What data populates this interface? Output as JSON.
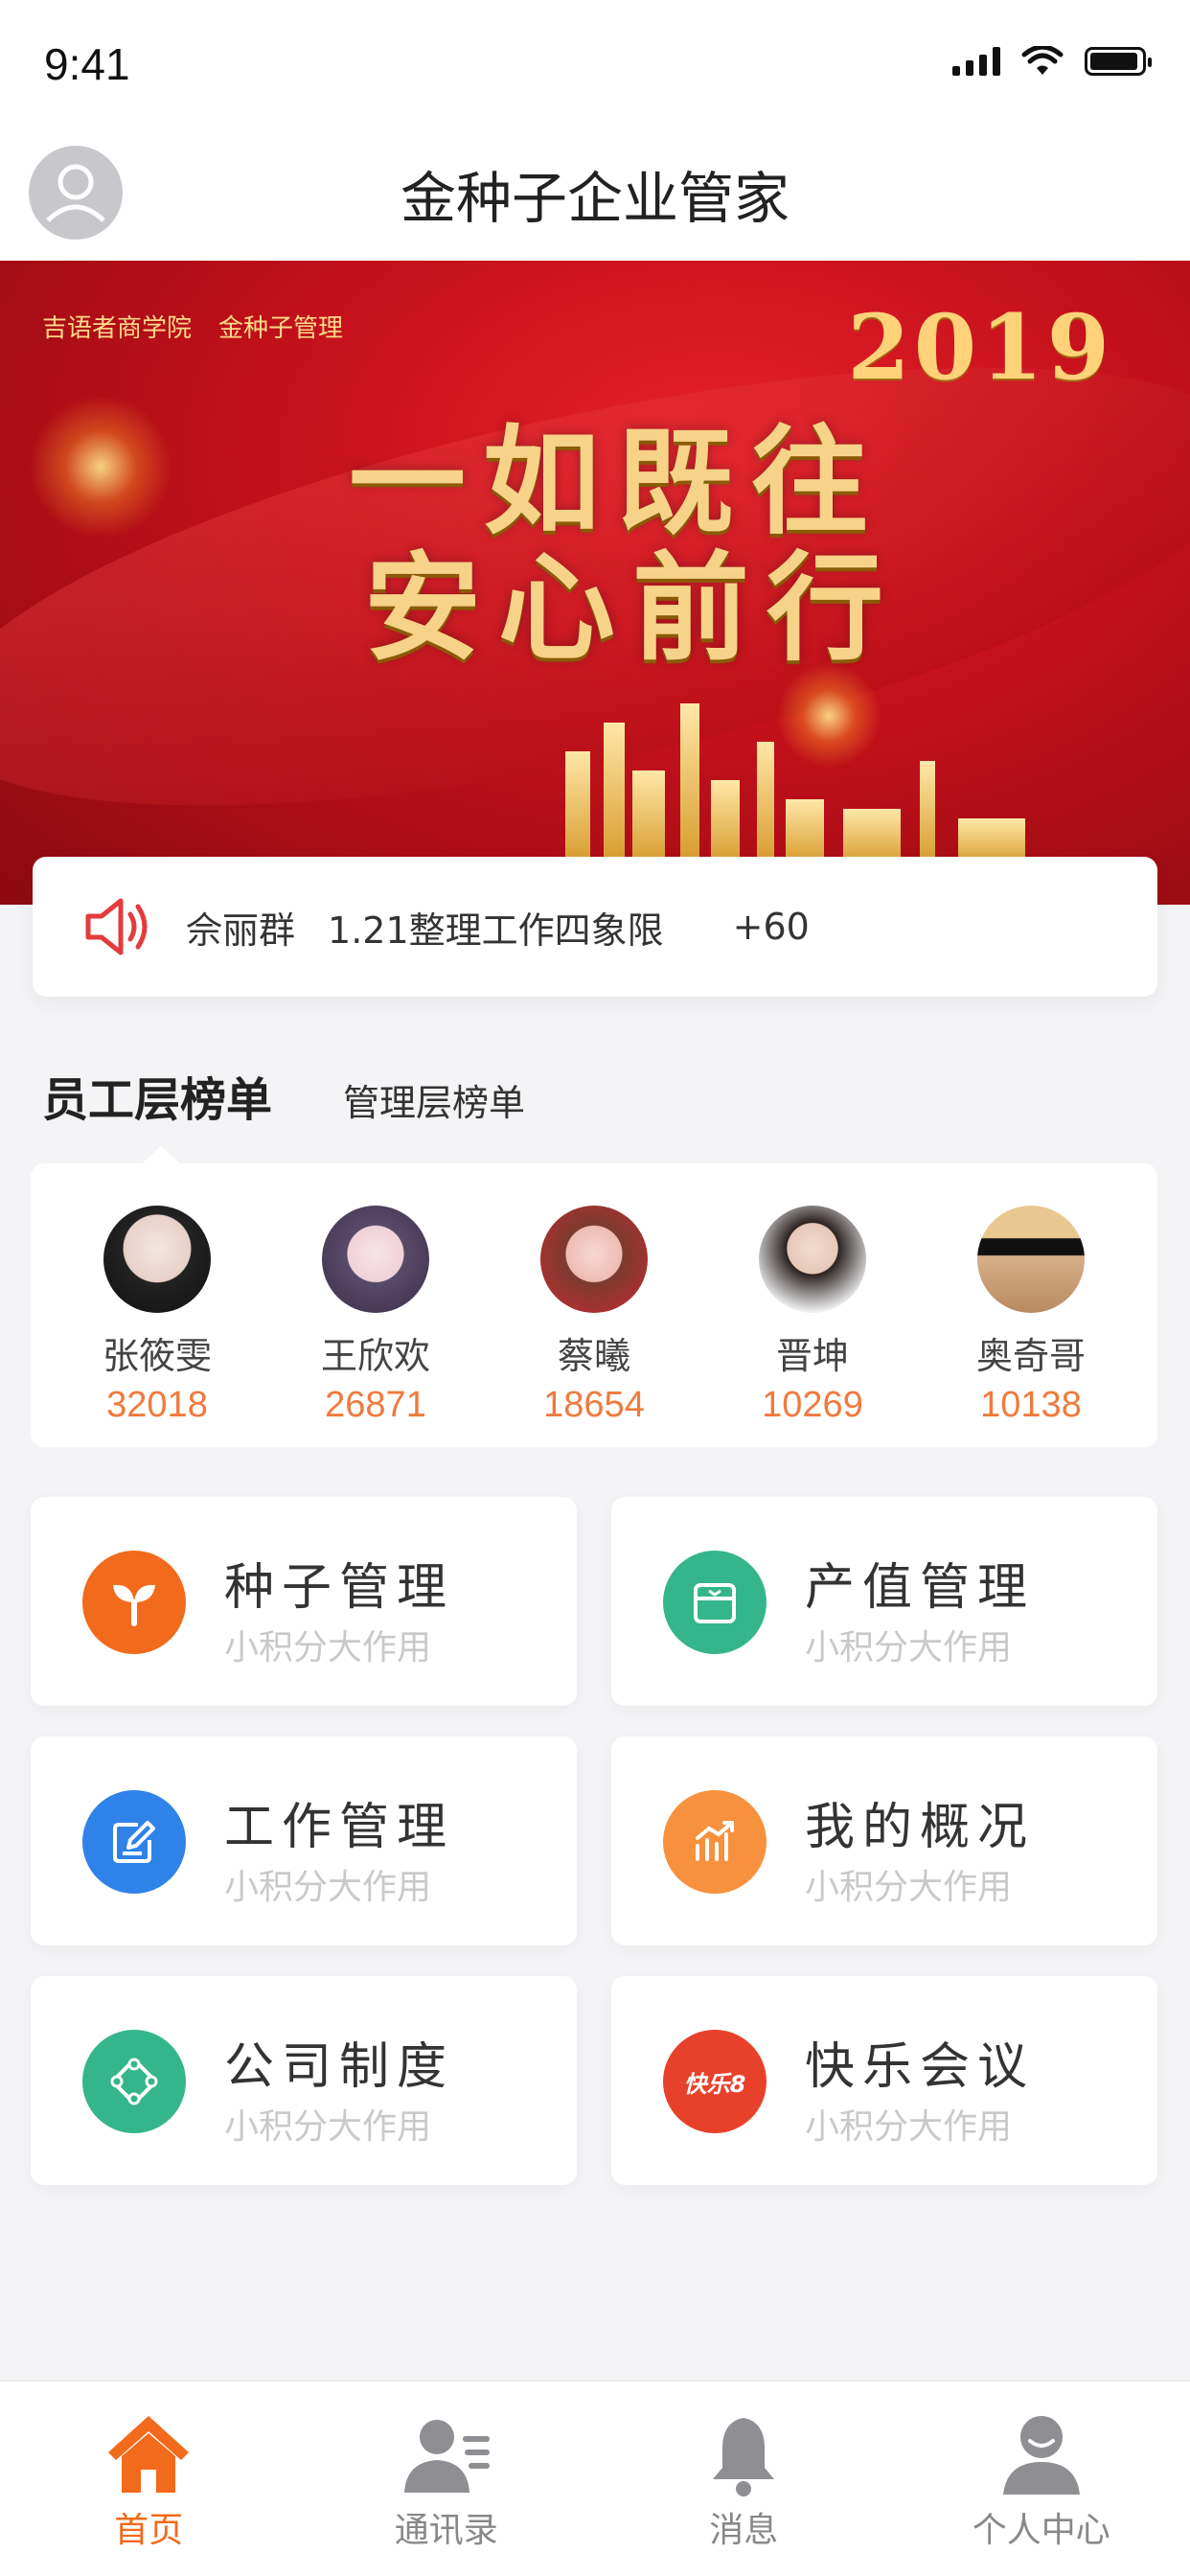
{
  "status_bar": {
    "time": "9:41"
  },
  "header": {
    "title": "金种子企业管家"
  },
  "banner": {
    "logo_left": "吉语者商学院",
    "logo_right": "金种子管理",
    "year": "2019",
    "line1": "一如既往",
    "line2": "安心前行"
  },
  "notice": {
    "name": "佘丽群",
    "text": "1.21整理工作四象限",
    "points": "+60"
  },
  "leaderboard": {
    "tabs": [
      {
        "label": "员工层榜单",
        "active": true
      },
      {
        "label": "管理层榜单",
        "active": false
      }
    ],
    "entries": [
      {
        "name": "张筱雯",
        "score": "32018"
      },
      {
        "name": "王欣欢",
        "score": "26871"
      },
      {
        "name": "蔡曦",
        "score": "18654"
      },
      {
        "name": "晋坤",
        "score": "10269"
      },
      {
        "name": "奥奇哥",
        "score": "10138"
      }
    ]
  },
  "features": [
    {
      "title": "种子管理",
      "subtitle": "小积分大作用",
      "icon": "seed-icon",
      "color": "#f26a1b"
    },
    {
      "title": "产值管理",
      "subtitle": "小积分大作用",
      "icon": "box-icon",
      "color": "#35b58b"
    },
    {
      "title": "工作管理",
      "subtitle": "小积分大作用",
      "icon": "edit-icon",
      "color": "#2f83e8"
    },
    {
      "title": "我的概况",
      "subtitle": "小积分大作用",
      "icon": "chart-icon",
      "color": "#f7913d"
    },
    {
      "title": "公司制度",
      "subtitle": "小积分大作用",
      "icon": "policy-icon",
      "color": "#35b58b"
    },
    {
      "title": "快乐会议",
      "subtitle": "小积分大作用",
      "icon": "meeting-icon",
      "color": "#e8412b",
      "badge": "快乐8"
    }
  ],
  "tab_bar": {
    "items": [
      {
        "label": "首页",
        "icon": "home-icon",
        "active": true
      },
      {
        "label": "通讯录",
        "icon": "contacts-icon",
        "active": false
      },
      {
        "label": "消息",
        "icon": "bell-icon",
        "active": false
      },
      {
        "label": "个人中心",
        "icon": "person-icon",
        "active": false
      }
    ]
  },
  "colors": {
    "accent": "#f26a1b",
    "score": "#f07a3e",
    "banner_red": "#c2101a",
    "gold": "#f7d38a"
  }
}
